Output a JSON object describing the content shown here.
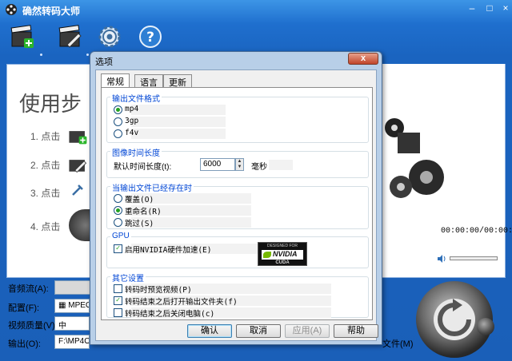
{
  "app": {
    "title": "确然转码大师",
    "steps_title": "使用步",
    "steps": [
      "1. 点击",
      "2. 点击",
      "3. 点击",
      "4. 点击"
    ],
    "timecode": "00:00:00/00:00:00"
  },
  "bottom": {
    "audio_label": "音频流(A):",
    "config_label": "配置(F):",
    "config_value": "MPEG-",
    "quality_label": "视频质量(V):",
    "quality_value": "中",
    "output_label": "输出(O):",
    "output_value": "F:\\MP4Out",
    "folder_text": "文件(M)"
  },
  "dialog": {
    "title": "选项",
    "close_label": "x",
    "tabs": [
      {
        "label": "常规",
        "active": true
      },
      {
        "label": "语言",
        "active": false
      },
      {
        "label": "更新",
        "active": false
      }
    ],
    "groups": {
      "format": {
        "title": "输出文件格式",
        "options": [
          {
            "label": "mp4",
            "checked": true
          },
          {
            "label": "3gp",
            "checked": false
          },
          {
            "label": "f4v",
            "checked": false
          }
        ]
      },
      "duration": {
        "title": "图像时间长度",
        "label": "默认时间长度(t):",
        "value": "6000",
        "unit": "毫秒"
      },
      "exists": {
        "title": "当输出文件已经存在时",
        "options": [
          {
            "label": "覆盖(O)",
            "checked": false
          },
          {
            "label": "重命名(R)",
            "checked": true
          },
          {
            "label": "跳过(S)",
            "checked": false
          }
        ]
      },
      "gpu": {
        "title": "GPU",
        "option": {
          "label": "启用NVIDIA硬件加速(E)",
          "checked": true
        },
        "badge": {
          "top": "DESIGNED FOR",
          "brand": "NVIDIA",
          "bottom": "CUDA"
        }
      },
      "other": {
        "title": "其它设置",
        "options": [
          {
            "label": "转码时预览视频(P)",
            "checked": false
          },
          {
            "label": "转码结束之后打开输出文件夹(f)",
            "checked": true
          },
          {
            "label": "转码结束之后关闭电脑(c)",
            "checked": false
          }
        ]
      }
    },
    "buttons": {
      "ok": "确认",
      "cancel": "取消",
      "apply": "应用(A)",
      "help": "帮助"
    }
  },
  "colors": {
    "titlebar_blue": "#1f6fce",
    "group_title": "#0046d5",
    "nvidia_green": "#76b900"
  }
}
